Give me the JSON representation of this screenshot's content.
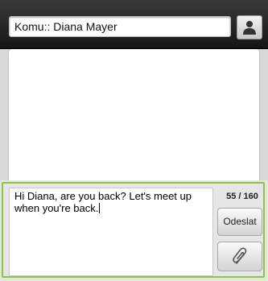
{
  "header": {
    "recipient_label": "Komu::",
    "recipient_name": "Diana Mayer",
    "contact_icon": "person-icon"
  },
  "composer": {
    "message_text": "Hi Diana, are you back? Let's meet up when you're back.",
    "char_counter": "55 / 160",
    "send_label": "Odeslat",
    "attach_icon": "paperclip-icon",
    "accent_color": "#8cc63e"
  }
}
